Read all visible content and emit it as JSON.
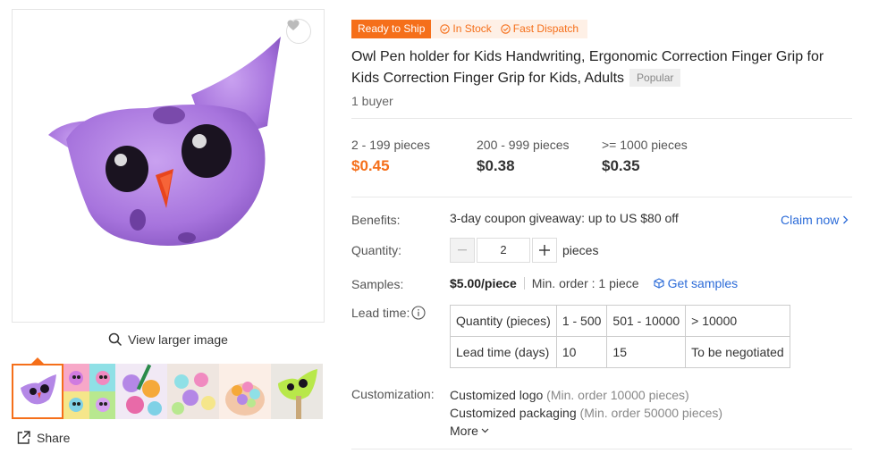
{
  "gallery": {
    "view_larger_label": "View larger image",
    "share_label": "Share",
    "thumbnail_count": 6,
    "active_thumbnail": 1
  },
  "badges": {
    "ready": "Ready to Ship",
    "in_stock": "In Stock",
    "fast_dispatch": "Fast Dispatch"
  },
  "product": {
    "title": "Owl Pen holder for Kids Handwriting, Ergonomic Correction Finger Grip for Kids Correction Finger Grip for Kids, Adults",
    "popular_tag": "Popular",
    "buyers": "1 buyer"
  },
  "price_tiers": [
    {
      "qty": "2 - 199 pieces",
      "price": "$0.45"
    },
    {
      "qty": "200 - 999 pieces",
      "price": "$0.38"
    },
    {
      "qty": ">= 1000 pieces",
      "price": "$0.35"
    }
  ],
  "benefits": {
    "label": "Benefits:",
    "text": "3-day coupon giveaway: up to US $80 off",
    "claim": "Claim now"
  },
  "quantity": {
    "label": "Quantity:",
    "value": "2",
    "unit": "pieces"
  },
  "samples": {
    "label": "Samples:",
    "price": "$5.00/piece",
    "min_order": "Min. order : 1 piece",
    "get_samples": "Get samples"
  },
  "lead_time": {
    "label": "Lead time:",
    "rows": [
      [
        "Quantity (pieces)",
        "1 - 500",
        "501 - 10000",
        "> 10000"
      ],
      [
        "Lead time (days)",
        "10",
        "15",
        "To be negotiated"
      ]
    ]
  },
  "customization": {
    "label": "Customization:",
    "items": [
      {
        "name": "Customized logo",
        "note": "(Min. order 10000 pieces)"
      },
      {
        "name": "Customized packaging",
        "note": "(Min. order 50000 pieces)"
      }
    ],
    "more": "More"
  },
  "colors": {
    "accent": "#f56f1a",
    "link": "#2b6bd8",
    "product_purple": "#b487e6"
  }
}
